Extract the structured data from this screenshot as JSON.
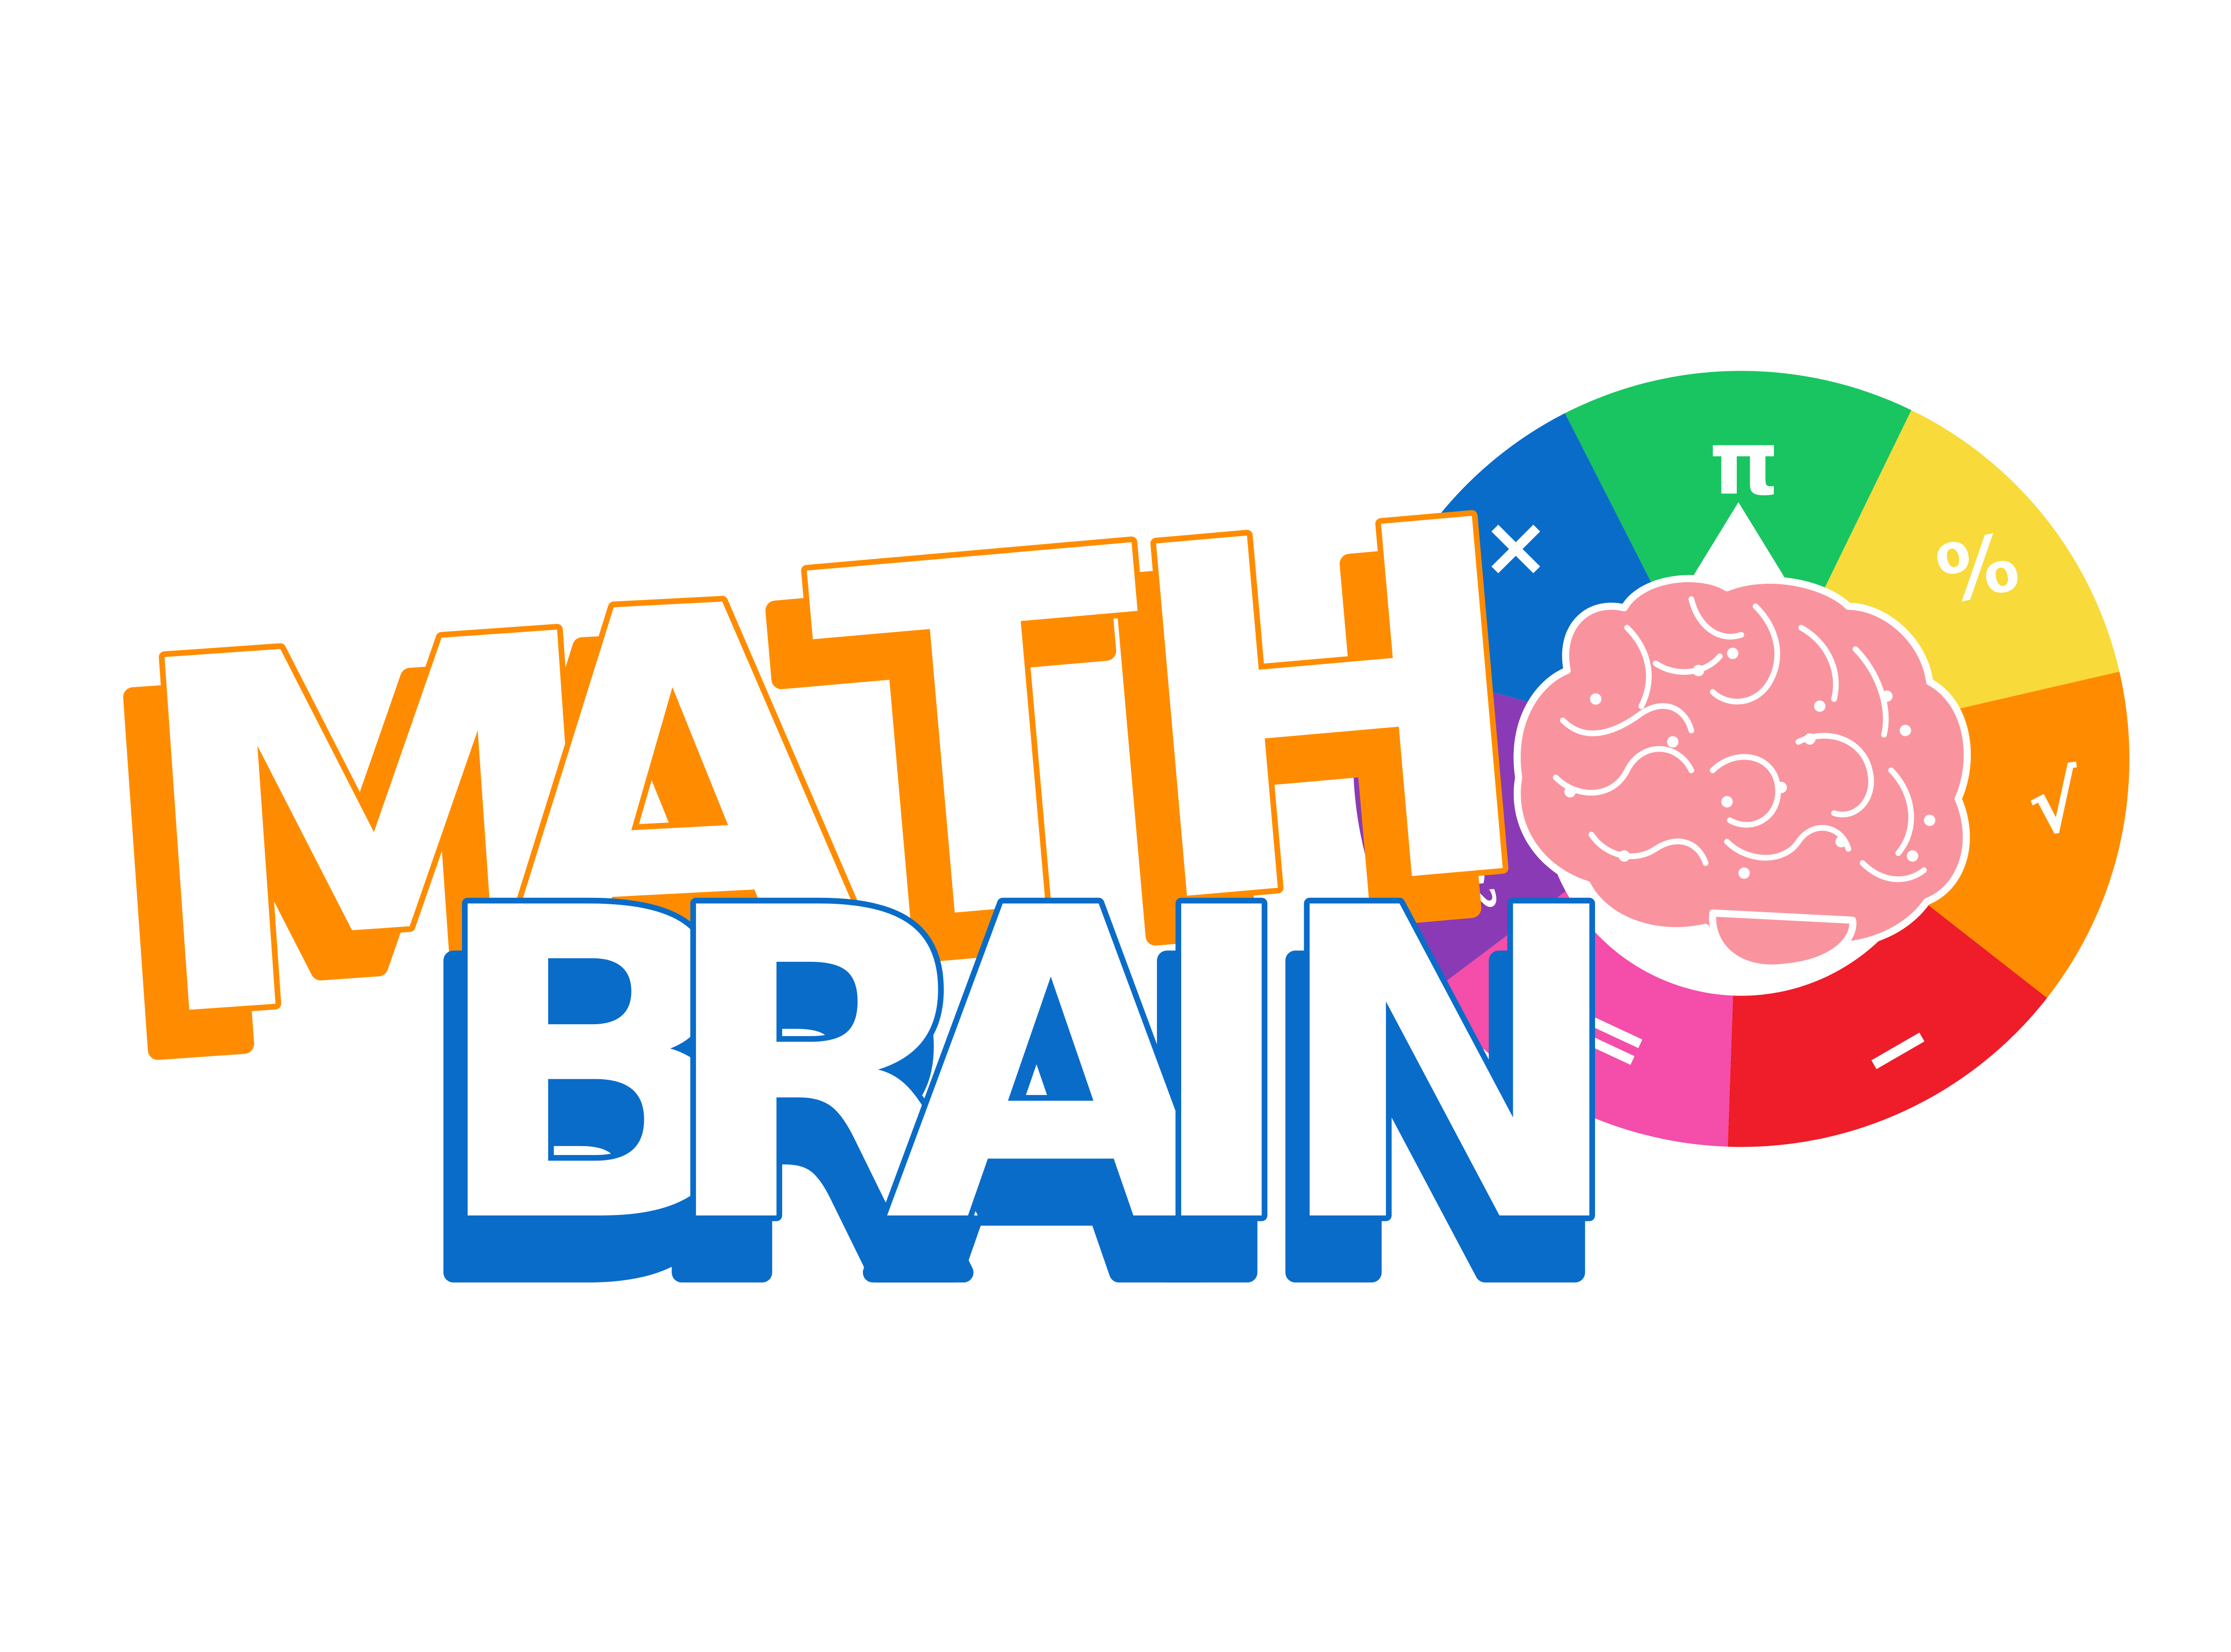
{
  "title": {
    "line1": {
      "letters": [
        "M",
        "A",
        "T",
        "H"
      ],
      "color": "#FF8C00"
    },
    "line2": {
      "letters": [
        "B",
        "R",
        "A",
        "I",
        "N"
      ],
      "color": "#0A6CC9"
    }
  },
  "wheel": {
    "pointer_color": "#FFFFFF",
    "brain_color": "#F9949E",
    "segments": [
      {
        "name": "multiply",
        "color": "#0A6CC9",
        "symbol": "×"
      },
      {
        "name": "pi",
        "color": "#18C560",
        "symbol": "π"
      },
      {
        "name": "percent",
        "color": "#F8DA3A",
        "symbol": "%"
      },
      {
        "name": "check",
        "color": "#FF8C00",
        "symbol": "√"
      },
      {
        "name": "minus",
        "color": "#EF1C2A",
        "symbol": "−"
      },
      {
        "name": "equals",
        "color": "#F44DAA",
        "symbol": "="
      },
      {
        "name": "formula",
        "color": "#8A3AB4",
        "symbol": "E=mc²"
      }
    ]
  },
  "colors": {
    "background": "#FFFFFF",
    "letter_fill": "#FFFFFF"
  },
  "icons": [
    "brain-icon",
    "wheel-pointer-icon"
  ]
}
